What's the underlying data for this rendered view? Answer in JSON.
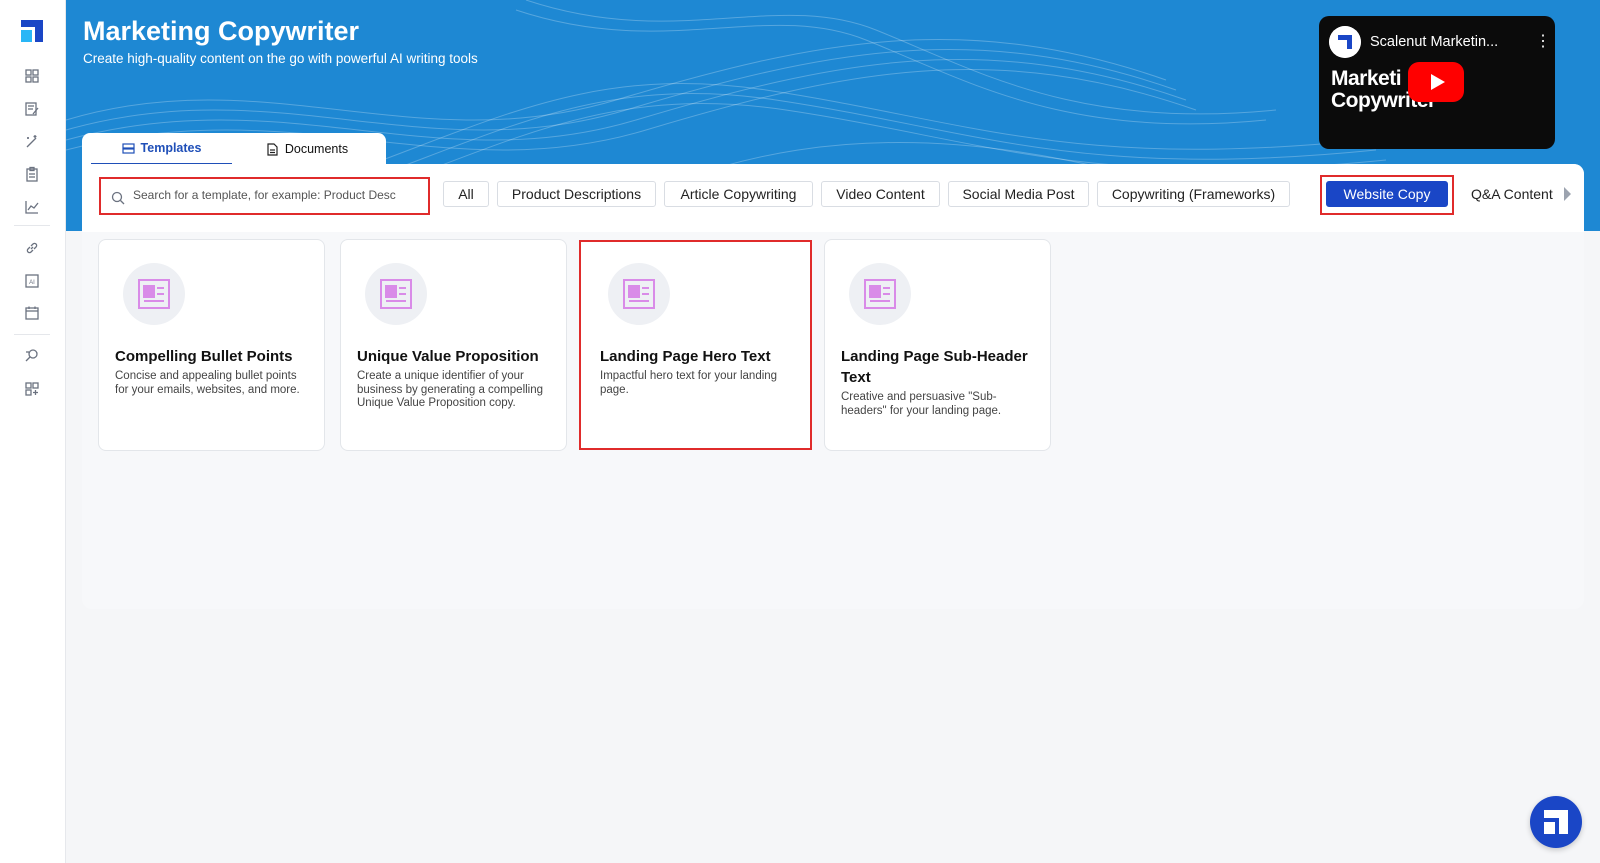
{
  "header": {
    "title": "Marketing Copywriter",
    "subtitle": "Create high-quality content on the go with powerful AI writing tools"
  },
  "video": {
    "channel_title": "Scalenut Marketin...",
    "thumbnail_text_line1": "Marketi",
    "thumbnail_text_line2": "Copywriter",
    "menu_glyph": "⋮"
  },
  "tabs": [
    {
      "label": "Templates",
      "icon": "templates-icon",
      "active": true
    },
    {
      "label": "Documents",
      "icon": "document-icon",
      "active": false
    }
  ],
  "search": {
    "placeholder": "Search for a template, for example: Product Desc",
    "value": ""
  },
  "categories": [
    {
      "label": "All",
      "active": false
    },
    {
      "label": "Product Descriptions",
      "active": false
    },
    {
      "label": "Article Copywriting",
      "active": false
    },
    {
      "label": "Video Content",
      "active": false
    },
    {
      "label": "Social Media Post",
      "active": false
    },
    {
      "label": "Copywriting (Frameworks)",
      "active": false
    },
    {
      "label": "Website Copy",
      "active": true
    },
    {
      "label": "Q&A Content",
      "active": false
    }
  ],
  "cards": [
    {
      "title": "Compelling Bullet Points",
      "description": "Concise and appealing bullet points for your emails, websites, and more."
    },
    {
      "title": "Unique Value Proposition",
      "description": "Create a unique identifier of your business by generating a compelling Unique Value Proposition copy."
    },
    {
      "title": "Landing Page Hero Text",
      "description": "Impactful hero text for your landing page."
    },
    {
      "title": "Landing Page Sub-Header Text",
      "description": "Creative and persuasive \"Sub-headers\" for your landing page."
    }
  ],
  "colors": {
    "banner": "#1e88d3",
    "accent": "#1a46c6",
    "highlight_border": "#e02b2b",
    "card_icon": "#d98be8"
  },
  "sidebar_icons": [
    "dashboard-icon",
    "document-edit-icon",
    "magic-wand-icon",
    "clipboard-icon",
    "chart-icon",
    "link-icon",
    "ai-icon",
    "calendar-icon",
    "search-doc-icon",
    "apps-add-icon"
  ]
}
